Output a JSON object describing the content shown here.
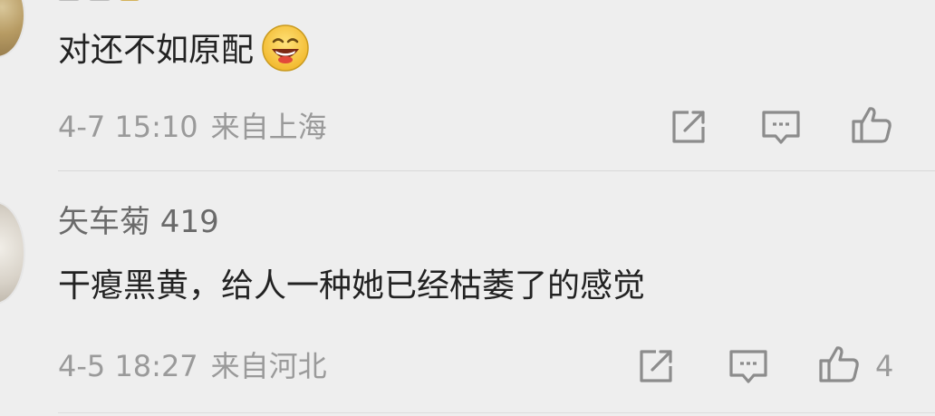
{
  "comments": [
    {
      "text": "对还不如原配",
      "emoji": "laughing-face-emoji",
      "time": "4-7 15:10",
      "location": "来自上海",
      "like_count": ""
    },
    {
      "username": "矢车菊 419",
      "text": "干瘪黑黄，给人一种她已经枯萎了的感觉",
      "time": "4-5 18:27",
      "location": "来自河北",
      "like_count": "4"
    }
  ],
  "icons": {
    "share": "share-icon",
    "comment": "comment-icon",
    "like": "thumbs-up-icon"
  },
  "colors": {
    "background": "#eeeeee",
    "text": "#222222",
    "meta": "#9a9a9a",
    "icon": "#8c8c8c"
  }
}
